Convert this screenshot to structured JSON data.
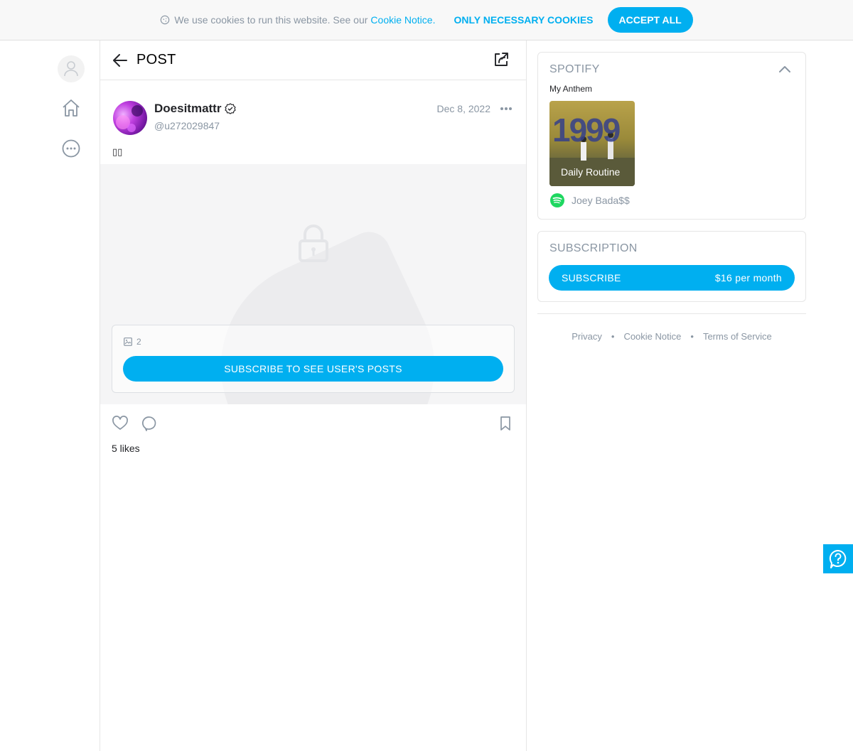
{
  "cookie_bar": {
    "text": "We use cookies to run this website. See our",
    "link": "Cookie Notice.",
    "necessary_label": "ONLY NECESSARY COOKIES",
    "accept_label": "ACCEPT ALL"
  },
  "nav": {
    "icons": [
      "user-icon",
      "home-icon",
      "more-icon"
    ]
  },
  "header": {
    "title": "POST"
  },
  "post": {
    "author_name": "Doesitmattr",
    "author_handle": "@u272029847",
    "date": "Dec 8, 2022",
    "text": "▯▯",
    "media_count": "2",
    "locked_button": "SUBSCRIBE TO SEE USER'S POSTS",
    "likes": "5 likes"
  },
  "spotify": {
    "title": "SPOTIFY",
    "anthem_label": "My Anthem",
    "album_text": "1999",
    "track": "Daily Routine",
    "artist": "Joey Bada$$"
  },
  "subscription": {
    "title": "SUBSCRIPTION",
    "button_label": "SUBSCRIBE",
    "price": "$16 per month"
  },
  "footer": {
    "privacy": "Privacy",
    "cookie_notice": "Cookie Notice",
    "terms": "Terms of Service"
  },
  "colors": {
    "accent": "#00aff0",
    "muted": "#8a96a3",
    "spotify_green": "#1ed760"
  }
}
